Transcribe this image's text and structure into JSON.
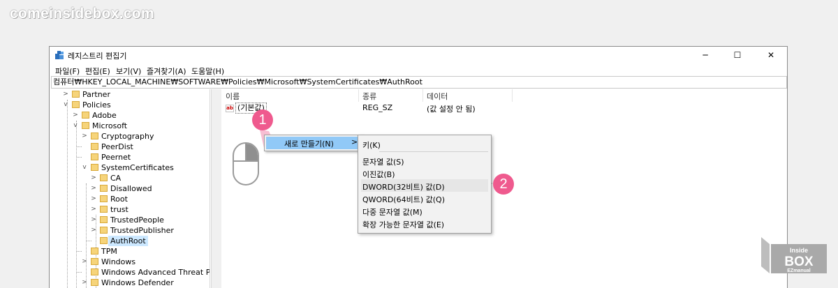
{
  "watermark": "comeinsidebox.com",
  "window": {
    "title": "레지스트리 편집기",
    "controls": {
      "minimize": "─",
      "maximize": "☐",
      "close": "✕"
    }
  },
  "menu": [
    "파일(F)",
    "편집(E)",
    "보기(V)",
    "즐겨찾기(A)",
    "도움말(H)"
  ],
  "address": "컴퓨터₩HKEY_LOCAL_MACHINE₩SOFTWARE₩Policies₩Microsoft₩SystemCertificates₩AuthRoot",
  "tree": [
    {
      "label": "Partner",
      "expander": ">"
    },
    {
      "label": "Policies",
      "expander": "v"
    },
    {
      "label": "Adobe",
      "expander": ">"
    },
    {
      "label": "Microsoft",
      "expander": "v"
    },
    {
      "label": "Cryptography",
      "expander": ">"
    },
    {
      "label": "PeerDist",
      "expander": ""
    },
    {
      "label": "Peernet",
      "expander": ""
    },
    {
      "label": "SystemCertificates",
      "expander": "v"
    },
    {
      "label": "CA",
      "expander": ">"
    },
    {
      "label": "Disallowed",
      "expander": ">"
    },
    {
      "label": "Root",
      "expander": ">"
    },
    {
      "label": "trust",
      "expander": ">"
    },
    {
      "label": "TrustedPeople",
      "expander": ">"
    },
    {
      "label": "TrustedPublisher",
      "expander": ">"
    },
    {
      "label": "AuthRoot",
      "expander": "",
      "selected": true
    },
    {
      "label": "TPM",
      "expander": ""
    },
    {
      "label": "Windows",
      "expander": ">"
    },
    {
      "label": "Windows Advanced Threat Protect",
      "expander": ""
    },
    {
      "label": "Windows Defender",
      "expander": ">"
    }
  ],
  "list": {
    "columns": [
      "이름",
      "종류",
      "데이터"
    ],
    "rows": [
      {
        "icon": "ab",
        "name": "(기본값)",
        "type": "REG_SZ",
        "data": "(값 설정 안 됨)"
      }
    ]
  },
  "context_menu": {
    "new_label": "새로 만들기(N)",
    "arrow": ">",
    "submenu": [
      "키(K)",
      "문자열 값(S)",
      "이진값(B)",
      "DWORD(32비트) 값(D)",
      "QWORD(64비트) 값(Q)",
      "다중 문자열 값(M)",
      "확장 가능한 문자열 값(E)"
    ],
    "highlighted_index": 3
  },
  "steps": [
    "1",
    "2"
  ],
  "colors": {
    "accent": "#ef5a8e",
    "menu_highlight": "#91c9f7",
    "selection": "#cce8ff"
  },
  "logo": {
    "line1": "Inside",
    "line2": "BOX",
    "line3": "EZmanual"
  }
}
